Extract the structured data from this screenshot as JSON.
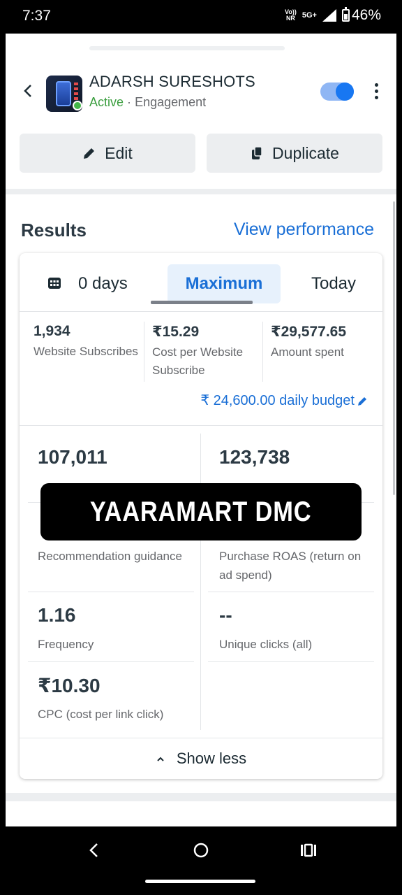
{
  "status_bar": {
    "time": "7:37",
    "network_top": "Vo))",
    "network_bottom": "NR",
    "network_type": "5G+",
    "battery": "46%"
  },
  "campaign": {
    "name": "ADARSH SURESHOTS",
    "status": "Active",
    "separator": "·",
    "objective": "Engagement",
    "toggle_on": true
  },
  "actions": {
    "edit_label": "Edit",
    "duplicate_label": "Duplicate"
  },
  "results": {
    "title": "Results",
    "view_performance": "View performance",
    "tabs": [
      {
        "label": "0 days"
      },
      {
        "label": "Maximum",
        "selected": true
      },
      {
        "label": "Today"
      }
    ],
    "top_metrics": [
      {
        "value": "1,934",
        "label": "Website Subscribes"
      },
      {
        "value": "₹15.29",
        "label": "Cost per Website Subscribe"
      },
      {
        "value": "₹29,577.65",
        "label": "Amount spent"
      }
    ],
    "budget": "₹ 24,600.00 daily budget",
    "grid_metrics": [
      {
        "value": "107,011",
        "label": ""
      },
      {
        "value": "123,738",
        "label": ""
      },
      {
        "value": "",
        "label": "Recommendation guidance"
      },
      {
        "value": "",
        "label": "Purchase ROAS (return on ad spend)"
      },
      {
        "value": "1.16",
        "label": "Frequency"
      },
      {
        "value": "--",
        "label": "Unique clicks (all)"
      },
      {
        "value": "₹10.30",
        "label": "CPC (cost per link click)"
      }
    ],
    "show_less": "Show less"
  },
  "overlay": {
    "text": "YAARAMART DMC"
  },
  "colors": {
    "accent": "#1a6fd6",
    "active_green": "#3b9e3f",
    "toggle": "#1877f2"
  },
  "icons": [
    "back-icon",
    "more-vert-icon",
    "pencil-icon",
    "copy-icon",
    "calendar-icon",
    "chevron-up-icon",
    "nav-back-icon",
    "nav-home-icon",
    "nav-recents-icon"
  ]
}
